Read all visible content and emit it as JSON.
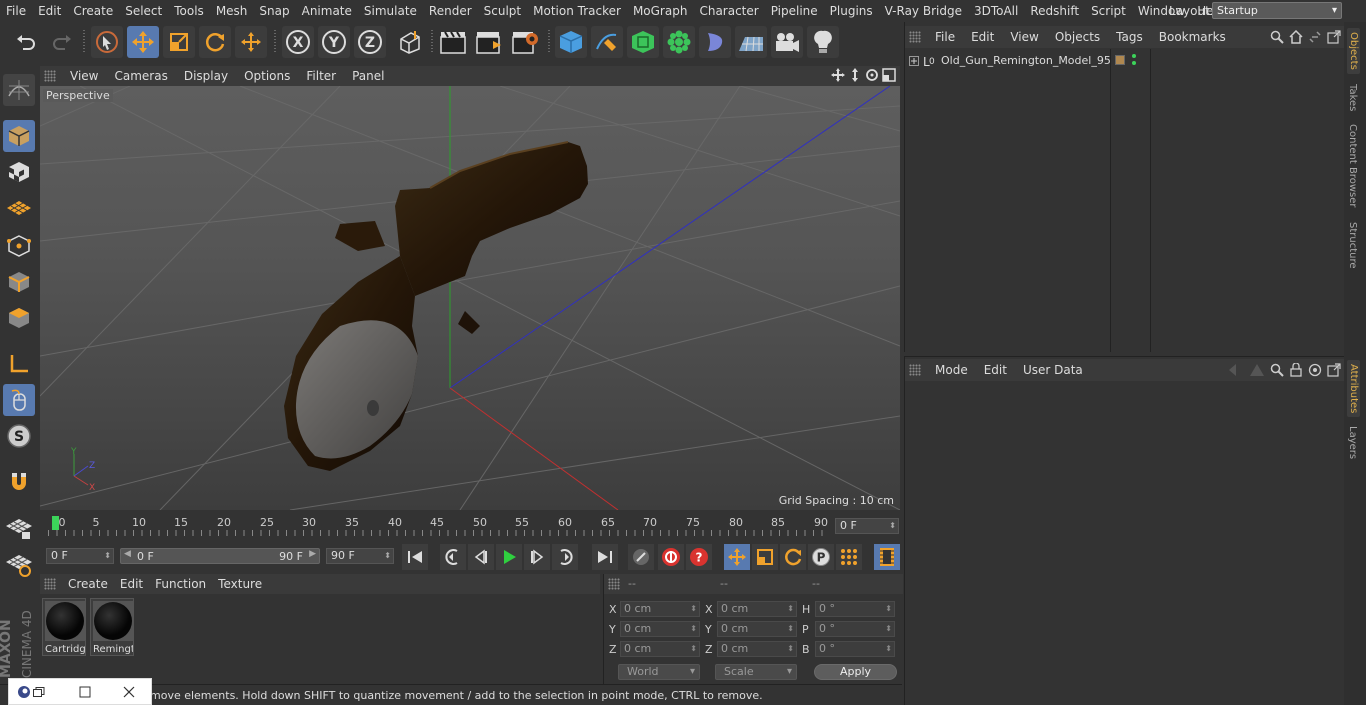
{
  "menu": [
    "File",
    "Edit",
    "Create",
    "Select",
    "Tools",
    "Mesh",
    "Snap",
    "Animate",
    "Simulate",
    "Render",
    "Sculpt",
    "Motion Tracker",
    "MoGraph",
    "Character",
    "Pipeline",
    "Plugins",
    "V-Ray Bridge",
    "3DToAll",
    "Redshift",
    "Script",
    "Window",
    "Help"
  ],
  "layout": {
    "label": "Layout:",
    "value": "Startup"
  },
  "toolbar_icons": [
    "undo-icon",
    "redo-icon",
    "live-selection-icon",
    "move-icon",
    "scale-icon",
    "rotate-icon",
    "recent-tool-icon",
    "x-axis-icon",
    "y-axis-icon",
    "z-axis-icon",
    "coordinate-system-icon",
    "render-view-icon",
    "render-picture-viewer-icon",
    "render-settings-icon",
    "cube-icon",
    "pen-icon",
    "subdivision-icon",
    "cloner-icon",
    "deformer-icon",
    "floor-icon",
    "camera-icon",
    "light-icon"
  ],
  "left_icons": [
    "make-editable-icon",
    "model-mode-icon",
    "texture-mode-icon",
    "workplane-icon",
    "points-mode-icon",
    "edges-mode-icon",
    "polygons-mode-icon",
    "axis-mode-icon",
    "tweak-icon",
    "solo-icon",
    "snapping-icon",
    "workplane-lock-icon",
    "spline-snap-icon"
  ],
  "viewport": {
    "menu": [
      "View",
      "Cameras",
      "Display",
      "Options",
      "Filter",
      "Panel"
    ],
    "label": "Perspective",
    "grid_spacing": "Grid Spacing : 10 cm",
    "axis_labels": {
      "x": "X",
      "y": "Y",
      "z": "Z"
    }
  },
  "timeline": {
    "ticks": [
      "0",
      "5",
      "10",
      "15",
      "20",
      "25",
      "30",
      "35",
      "40",
      "45",
      "50",
      "55",
      "60",
      "65",
      "70",
      "75",
      "80",
      "85",
      "90"
    ],
    "current_frame": "0 F",
    "start_field": "0 F",
    "range_min": "0 F",
    "range_max": "90 F",
    "end_field": "90 F"
  },
  "materials": {
    "menu": [
      "Create",
      "Edit",
      "Function",
      "Texture"
    ],
    "items": [
      {
        "name": "Cartridg"
      },
      {
        "name": "Remingt"
      }
    ]
  },
  "coordinates": {
    "headers": [
      "--",
      "--",
      "--"
    ],
    "rows": [
      {
        "l1": "X",
        "v1": "0 cm",
        "l2": "X",
        "v2": "0 cm",
        "l3": "H",
        "v3": "0 °"
      },
      {
        "l1": "Y",
        "v1": "0 cm",
        "l2": "Y",
        "v2": "0 cm",
        "l3": "P",
        "v3": "0 °"
      },
      {
        "l1": "Z",
        "v1": "0 cm",
        "l2": "Z",
        "v2": "0 cm",
        "l3": "B",
        "v3": "0 °"
      }
    ],
    "space": "World",
    "mode": "Scale",
    "apply": "Apply"
  },
  "status": "move elements. Hold down SHIFT to quantize movement / add to the selection in point mode, CTRL to remove.",
  "brand": {
    "maxon": "MAXON",
    "product": "CINEMA 4D"
  },
  "objects": {
    "menu": [
      "File",
      "Edit",
      "View",
      "Objects",
      "Tags",
      "Bookmarks"
    ],
    "items": [
      {
        "name": "Old_Gun_Remington_Model_95"
      }
    ]
  },
  "attributes": {
    "menu": [
      "Mode",
      "Edit",
      "User Data"
    ]
  },
  "right_tabs": [
    "Objects",
    "Takes",
    "Content Browser",
    "Structure",
    "Attributes",
    "Layers"
  ],
  "colors": {
    "accent": "#587ab0",
    "tab_active": "#e0b04c",
    "play": "#2fcf3f",
    "record": "#d9332f"
  }
}
